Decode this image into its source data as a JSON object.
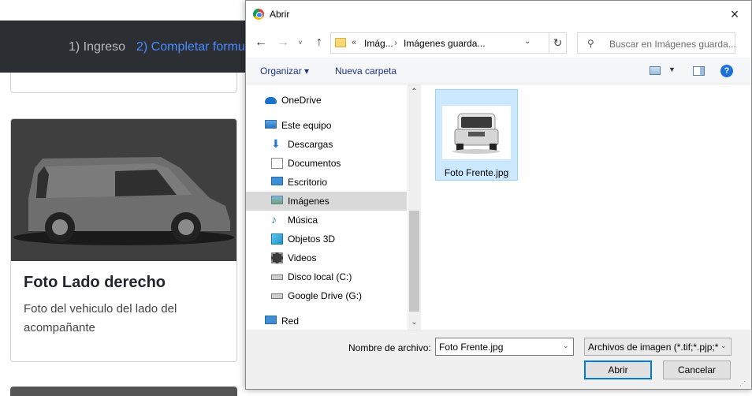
{
  "background_page": {
    "nav_steps": [
      "1) Ingreso",
      "2) Completar formu"
    ],
    "card": {
      "title": "Foto Lado derecho",
      "description": "Foto del vehiculo del lado del acompañante"
    }
  },
  "dialog": {
    "title": "Abrir",
    "close_icon": "×",
    "address": {
      "chevrons": "«",
      "crumbs": [
        "Imág...",
        "Imágenes guarda..."
      ]
    },
    "search_placeholder": "Buscar en Imágenes guarda...",
    "toolbar": {
      "organize": "Organizar ▾",
      "new_folder": "Nueva carpeta",
      "help": "?"
    },
    "nav_items": [
      {
        "label": "OneDrive",
        "icon": "onedrive-icon"
      },
      {
        "label": "Este equipo",
        "icon": "computer-icon"
      },
      {
        "label": "Descargas",
        "icon": "download-icon"
      },
      {
        "label": "Documentos",
        "icon": "document-icon"
      },
      {
        "label": "Escritorio",
        "icon": "desktop-icon"
      },
      {
        "label": "Imágenes",
        "icon": "pictures-icon",
        "selected": true
      },
      {
        "label": "Música",
        "icon": "music-icon"
      },
      {
        "label": "Objetos 3D",
        "icon": "objects3d-icon"
      },
      {
        "label": "Videos",
        "icon": "video-icon"
      },
      {
        "label": "Disco local (C:)",
        "icon": "drive-icon"
      },
      {
        "label": "Google Drive (G:)",
        "icon": "drive-icon"
      },
      {
        "label": "Red",
        "icon": "network-icon"
      }
    ],
    "file": {
      "name": "Foto Frente.jpg"
    },
    "bottom": {
      "filename_label": "Nombre de archivo:",
      "filename_value": "Foto Frente.jpg",
      "filetype_value": "Archivos de imagen (*.tif;*.pjp;*",
      "open_label": "Abrir",
      "cancel_label": "Cancelar"
    },
    "colors": {
      "accent": "#0078d7",
      "selection": "#cce8ff",
      "link": "#1e3287"
    }
  }
}
